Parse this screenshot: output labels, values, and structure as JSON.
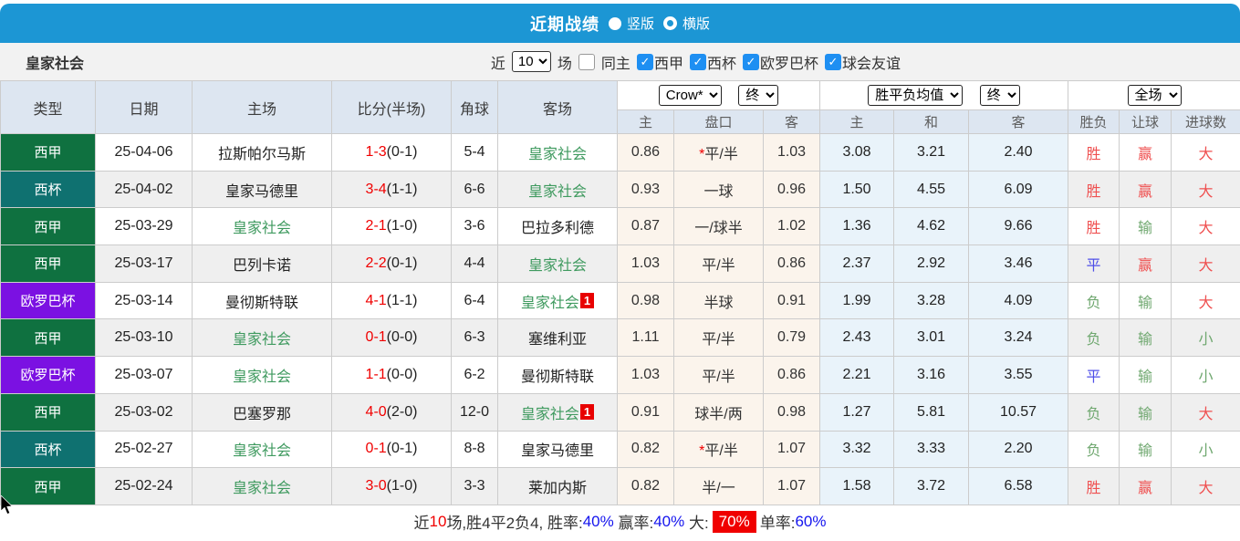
{
  "header": {
    "title": "近期战绩",
    "vertical_label": "竖版",
    "horizontal_label": "横版"
  },
  "filter": {
    "team": "皇家社会",
    "near_label": "近",
    "count_value": "10",
    "games_label": "场",
    "same_home_label": "同主",
    "leagues": [
      "西甲",
      "西杯",
      "欧罗巴杯",
      "球会友谊"
    ]
  },
  "table": {
    "col_headers": {
      "type": "类型",
      "date": "日期",
      "home": "主场",
      "score": "比分(半场)",
      "corner": "角球",
      "away": "客场"
    },
    "dropdowns": {
      "bookmaker": "Crow*",
      "odds_time": "终",
      "mean": "胜平负均值",
      "mean_time": "终",
      "full_match": "全场"
    },
    "sub_headers": [
      "主",
      "盘口",
      "客",
      "主",
      "和",
      "客",
      "胜负",
      "让球",
      "进球数"
    ],
    "rows": [
      {
        "type": "西甲",
        "league": "xijia",
        "date": "25-04-06",
        "home": "拉斯帕尔马斯",
        "homeSelf": false,
        "score": "1-3",
        "half": "(0-1)",
        "corner": "5-4",
        "away": "皇家社会",
        "awaySelf": true,
        "badge": "",
        "odds": [
          "0.86",
          "*平/半",
          "1.03"
        ],
        "mean": [
          "3.08",
          "3.21",
          "2.40"
        ],
        "res": [
          [
            "胜",
            "r"
          ],
          [
            "赢",
            "r"
          ],
          [
            "大",
            "r"
          ]
        ]
      },
      {
        "type": "西杯",
        "league": "xibei",
        "date": "25-04-02",
        "home": "皇家马德里",
        "homeSelf": false,
        "score": "3-4",
        "half": "(1-1)",
        "corner": "6-6",
        "away": "皇家社会",
        "awaySelf": true,
        "badge": "",
        "odds": [
          "0.93",
          "一球",
          "0.96"
        ],
        "mean": [
          "1.50",
          "4.55",
          "6.09"
        ],
        "res": [
          [
            "胜",
            "r"
          ],
          [
            "赢",
            "r"
          ],
          [
            "大",
            "r"
          ]
        ]
      },
      {
        "type": "西甲",
        "league": "xijia",
        "date": "25-03-29",
        "home": "皇家社会",
        "homeSelf": true,
        "score": "2-1",
        "half": "(1-0)",
        "corner": "3-6",
        "away": "巴拉多利德",
        "awaySelf": false,
        "badge": "",
        "odds": [
          "0.87",
          "一/球半",
          "1.02"
        ],
        "mean": [
          "1.36",
          "4.62",
          "9.66"
        ],
        "res": [
          [
            "胜",
            "r"
          ],
          [
            "输",
            "g"
          ],
          [
            "大",
            "r"
          ]
        ]
      },
      {
        "type": "西甲",
        "league": "xijia",
        "date": "25-03-17",
        "home": "巴列卡诺",
        "homeSelf": false,
        "score": "2-2",
        "half": "(0-1)",
        "corner": "4-4",
        "away": "皇家社会",
        "awaySelf": true,
        "badge": "",
        "odds": [
          "1.03",
          "平/半",
          "0.86"
        ],
        "mean": [
          "2.37",
          "2.92",
          "3.46"
        ],
        "res": [
          [
            "平",
            "b"
          ],
          [
            "赢",
            "r"
          ],
          [
            "大",
            "r"
          ]
        ]
      },
      {
        "type": "欧罗巴杯",
        "league": "ouluoba",
        "date": "25-03-14",
        "home": "曼彻斯特联",
        "homeSelf": false,
        "score": "4-1",
        "half": "(1-1)",
        "corner": "6-4",
        "away": "皇家社会",
        "awaySelf": true,
        "badge": "1",
        "odds": [
          "0.98",
          "半球",
          "0.91"
        ],
        "mean": [
          "1.99",
          "3.28",
          "4.09"
        ],
        "res": [
          [
            "负",
            "g"
          ],
          [
            "输",
            "g"
          ],
          [
            "大",
            "r"
          ]
        ]
      },
      {
        "type": "西甲",
        "league": "xijia",
        "date": "25-03-10",
        "home": "皇家社会",
        "homeSelf": true,
        "score": "0-1",
        "half": "(0-0)",
        "corner": "6-3",
        "away": "塞维利亚",
        "awaySelf": false,
        "badge": "",
        "odds": [
          "1.11",
          "平/半",
          "0.79"
        ],
        "mean": [
          "2.43",
          "3.01",
          "3.24"
        ],
        "res": [
          [
            "负",
            "g"
          ],
          [
            "输",
            "g"
          ],
          [
            "小",
            "g"
          ]
        ]
      },
      {
        "type": "欧罗巴杯",
        "league": "ouluoba",
        "date": "25-03-07",
        "home": "皇家社会",
        "homeSelf": true,
        "score": "1-1",
        "half": "(0-0)",
        "corner": "6-2",
        "away": "曼彻斯特联",
        "awaySelf": false,
        "badge": "",
        "odds": [
          "1.03",
          "平/半",
          "0.86"
        ],
        "mean": [
          "2.21",
          "3.16",
          "3.55"
        ],
        "res": [
          [
            "平",
            "b"
          ],
          [
            "输",
            "g"
          ],
          [
            "小",
            "g"
          ]
        ]
      },
      {
        "type": "西甲",
        "league": "xijia",
        "date": "25-03-02",
        "home": "巴塞罗那",
        "homeSelf": false,
        "score": "4-0",
        "half": "(2-0)",
        "corner": "12-0",
        "away": "皇家社会",
        "awaySelf": true,
        "badge": "1",
        "odds": [
          "0.91",
          "球半/两",
          "0.98"
        ],
        "mean": [
          "1.27",
          "5.81",
          "10.57"
        ],
        "res": [
          [
            "负",
            "g"
          ],
          [
            "输",
            "g"
          ],
          [
            "大",
            "r"
          ]
        ]
      },
      {
        "type": "西杯",
        "league": "xibei",
        "date": "25-02-27",
        "home": "皇家社会",
        "homeSelf": true,
        "score": "0-1",
        "half": "(0-1)",
        "corner": "8-8",
        "away": "皇家马德里",
        "awaySelf": false,
        "badge": "",
        "odds": [
          "0.82",
          "*平/半",
          "1.07"
        ],
        "mean": [
          "3.32",
          "3.33",
          "2.20"
        ],
        "res": [
          [
            "负",
            "g"
          ],
          [
            "输",
            "g"
          ],
          [
            "小",
            "g"
          ]
        ]
      },
      {
        "type": "西甲",
        "league": "xijia",
        "date": "25-02-24",
        "home": "皇家社会",
        "homeSelf": true,
        "score": "3-0",
        "half": "(1-0)",
        "corner": "3-3",
        "away": "莱加内斯",
        "awaySelf": false,
        "badge": "",
        "odds": [
          "0.82",
          "半/一",
          "1.07"
        ],
        "mean": [
          "1.58",
          "3.72",
          "6.58"
        ],
        "res": [
          [
            "胜",
            "r"
          ],
          [
            "赢",
            "r"
          ],
          [
            "大",
            "r"
          ]
        ]
      }
    ]
  },
  "footer": {
    "segments": [
      {
        "text": "近",
        "style": "plain"
      },
      {
        "text": "10",
        "style": "red"
      },
      {
        "text": "场,胜4平2负4, 胜率:",
        "style": "plain"
      },
      {
        "text": "40%",
        "style": "blue"
      },
      {
        "text": " 赢率:",
        "style": "plain"
      },
      {
        "text": "40%",
        "style": "blue"
      },
      {
        "text": " 大:",
        "style": "plain"
      },
      {
        "text": "70%",
        "style": "redbg"
      },
      {
        "text": "单率:",
        "style": "plain"
      },
      {
        "text": "60%",
        "style": "blue"
      }
    ]
  },
  "colors": {
    "topbar": "#1c96d4",
    "liga": "#0f7140",
    "copa": "#0f7170",
    "europa": "#7b11e2",
    "self_team": "#3f9a5f",
    "win": "#ef5050",
    "draw": "#4f4fe8",
    "lose": "#70a870",
    "score": "#f00000",
    "odds_bg": "#fbf4ec",
    "mean_bg": "#e9f3fa"
  }
}
